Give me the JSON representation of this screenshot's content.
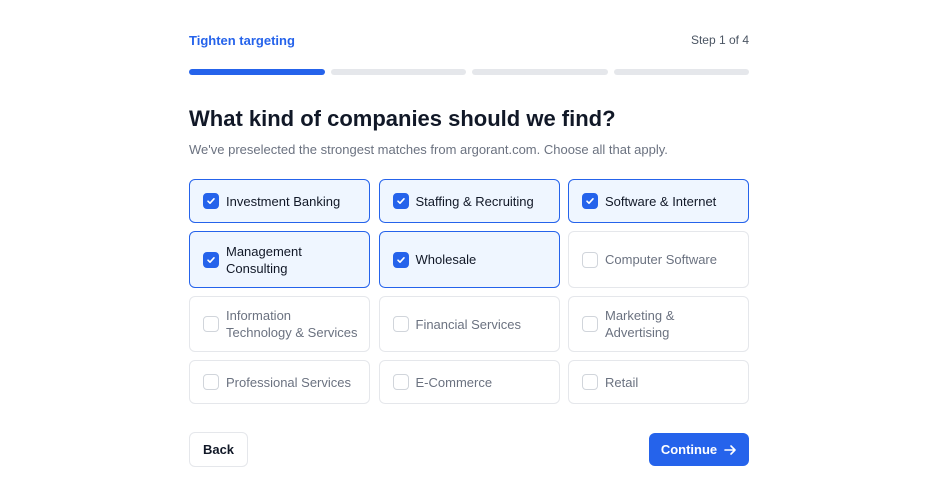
{
  "header": {
    "title": "Tighten targeting",
    "step": "Step 1 of 4"
  },
  "progress": {
    "current_step": 1,
    "total_steps": 4,
    "accent": "#2563eb"
  },
  "main": {
    "heading": "What kind of companies should we find?",
    "subtitle": "We've preselected the strongest matches from argorant.com. Choose all that apply."
  },
  "options": [
    {
      "label": "Investment Banking",
      "checked": true
    },
    {
      "label": "Staffing & Recruiting",
      "checked": true
    },
    {
      "label": "Software & Internet",
      "checked": true
    },
    {
      "label": "Management Consulting",
      "checked": true
    },
    {
      "label": "Wholesale",
      "checked": true
    },
    {
      "label": "Computer Software",
      "checked": false
    },
    {
      "label": "Information Technology & Services",
      "checked": false
    },
    {
      "label": "Financial Services",
      "checked": false
    },
    {
      "label": "Marketing & Advertising",
      "checked": false
    },
    {
      "label": "Professional Services",
      "checked": false
    },
    {
      "label": "E-Commerce",
      "checked": false
    },
    {
      "label": "Retail",
      "checked": false
    }
  ],
  "footer": {
    "back_label": "Back",
    "continue_label": "Continue",
    "continue_icon": "arrow-right-icon"
  }
}
